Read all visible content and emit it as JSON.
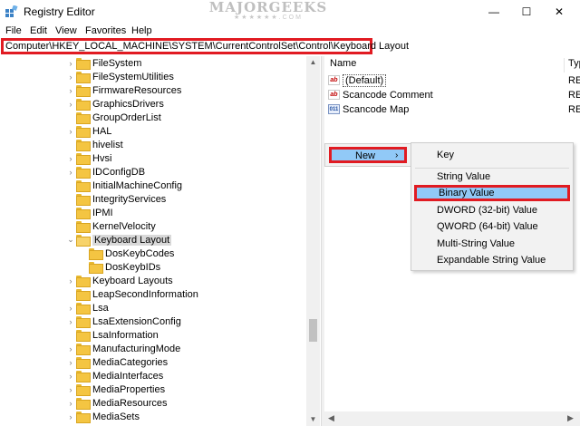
{
  "window": {
    "title": "Registry Editor",
    "watermark_main": "MAJORGEEKS",
    "watermark_sub": "★★★★★★.COM",
    "minimize_glyph": "—",
    "maximize_glyph": "☐",
    "close_glyph": "✕"
  },
  "menu": [
    "File",
    "Edit",
    "View",
    "Favorites",
    "Help"
  ],
  "address": {
    "path": "Computer\\HKEY_LOCAL_MACHINE\\SYSTEM\\CurrentControlSet\\Control\\Keyboard Layout"
  },
  "tree": {
    "items": [
      {
        "label": "FileSystem",
        "chevron": "›"
      },
      {
        "label": "FileSystemUtilities",
        "chevron": "›"
      },
      {
        "label": "FirmwareResources",
        "chevron": "›"
      },
      {
        "label": "GraphicsDrivers",
        "chevron": "›"
      },
      {
        "label": "GroupOrderList",
        "chevron": ""
      },
      {
        "label": "HAL",
        "chevron": "›"
      },
      {
        "label": "hivelist",
        "chevron": ""
      },
      {
        "label": "Hvsi",
        "chevron": "›"
      },
      {
        "label": "IDConfigDB",
        "chevron": "›"
      },
      {
        "label": "InitialMachineConfig",
        "chevron": ""
      },
      {
        "label": "IntegrityServices",
        "chevron": ""
      },
      {
        "label": "IPMI",
        "chevron": ""
      },
      {
        "label": "KernelVelocity",
        "chevron": ""
      },
      {
        "label": "Keyboard Layout",
        "chevron": "⌄"
      },
      {
        "label": "DosKeybCodes",
        "chevron": ""
      },
      {
        "label": "DosKeybIDs",
        "chevron": ""
      },
      {
        "label": "Keyboard Layouts",
        "chevron": "›"
      },
      {
        "label": "LeapSecondInformation",
        "chevron": ""
      },
      {
        "label": "Lsa",
        "chevron": "›"
      },
      {
        "label": "LsaExtensionConfig",
        "chevron": "›"
      },
      {
        "label": "LsaInformation",
        "chevron": ""
      },
      {
        "label": "ManufacturingMode",
        "chevron": "›"
      },
      {
        "label": "MediaCategories",
        "chevron": "›"
      },
      {
        "label": "MediaInterfaces",
        "chevron": "›"
      },
      {
        "label": "MediaProperties",
        "chevron": "›"
      },
      {
        "label": "MediaResources",
        "chevron": "›"
      },
      {
        "label": "MediaSets",
        "chevron": "›"
      }
    ],
    "scroll_up_glyph": "▲",
    "scroll_down_glyph": "▼"
  },
  "list": {
    "col_name": "Name",
    "col_type": "Typ",
    "rows": [
      {
        "name": "(Default)",
        "type": "RE",
        "icon": "ab"
      },
      {
        "name": "Scancode Comment",
        "type": "RE",
        "icon": "ab"
      },
      {
        "name": "Scancode Map",
        "type": "RE",
        "icon": "011"
      }
    ],
    "scroll_left_glyph": "◀",
    "scroll_right_glyph": "▶"
  },
  "context_menu": {
    "new_label": "New",
    "new_arrow": "›"
  },
  "submenu": {
    "items": [
      "Key",
      "String Value",
      "Binary Value",
      "DWORD (32-bit) Value",
      "QWORD (64-bit) Value",
      "Multi-String Value",
      "Expandable String Value"
    ],
    "highlighted": "Binary Value"
  },
  "colors": {
    "highlight_outline": "#e11b22",
    "menu_hover": "#91c9f7"
  }
}
